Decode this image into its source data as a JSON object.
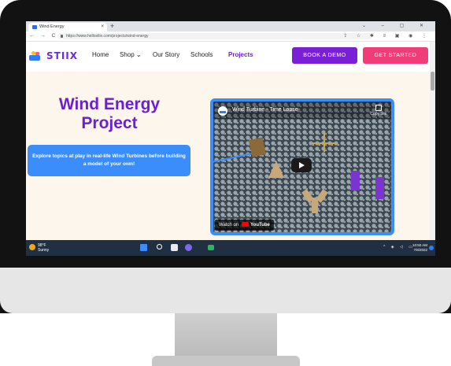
{
  "browser": {
    "tab_title": "Wind Energy",
    "tab_close": "×",
    "new_tab": "+",
    "window_controls": "⌄ – ▢ ✕",
    "nav_buttons": "← → C",
    "url": "https://www.hellostiix.com/projects/wind-energy",
    "extension_icons": "⇪ ☆ ✱ ≡ ▣ ◉ ⋮"
  },
  "site": {
    "logo_text": "STIIX",
    "nav": {
      "home": "Home",
      "shop": "Shop ⌄",
      "our_story": "Our Story",
      "schools": "Schools",
      "projects": "Projects"
    },
    "book_demo": "BOOK A DEMO",
    "get_started": "GET STARTED"
  },
  "hero": {
    "title_line1": "Wind Energy",
    "title_line2": "Project",
    "description": "Explore topics at play in real-life Wind Turbines before building a model of your own!"
  },
  "video": {
    "title": "Wind Turbine - Time Lapse",
    "copy_link": "Copy link",
    "watch_on": "Watch on",
    "youtube": "YouTube"
  },
  "taskbar": {
    "weather_temp": "98°F",
    "weather_desc": "Sunny",
    "tray_icons": "^ ◈ ◁ ▭",
    "time": "10:50 AM",
    "date": "7/8/2022"
  },
  "colors": {
    "brand_purple": "#6a1fd2",
    "demo_button": "#7a1fd6",
    "start_button": "#f03d7a",
    "accent_blue": "#3c8dfc",
    "taskbar": "#203042"
  }
}
